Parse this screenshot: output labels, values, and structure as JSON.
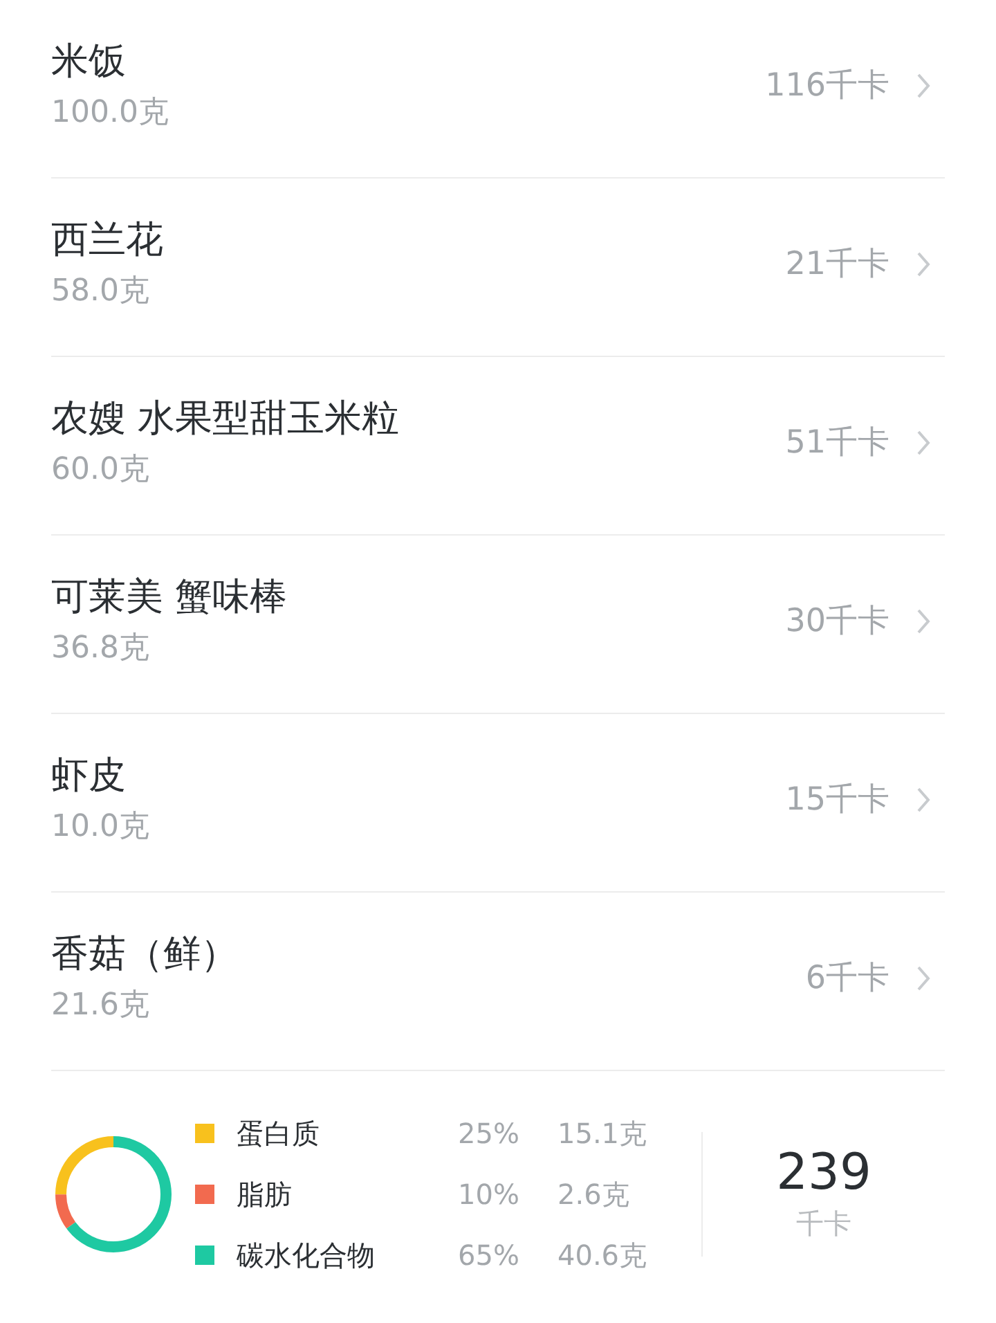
{
  "foods": [
    {
      "name": "米饭",
      "amount": "100.0克",
      "calories": "116千卡"
    },
    {
      "name": "西兰花",
      "amount": "58.0克",
      "calories": "21千卡"
    },
    {
      "name": "农嫂 水果型甜玉米粒",
      "amount": "60.0克",
      "calories": "51千卡"
    },
    {
      "name": "可莱美 蟹味棒",
      "amount": "36.8克",
      "calories": "30千卡"
    },
    {
      "name": "虾皮",
      "amount": "10.0克",
      "calories": "15千卡"
    },
    {
      "name": "香菇（鲜）",
      "amount": "21.6克",
      "calories": "6千卡"
    }
  ],
  "summary": {
    "nutrients": [
      {
        "name": "蛋白质",
        "percent": "25%",
        "amount": "15.1克",
        "color": "#f8c11d"
      },
      {
        "name": "脂肪",
        "percent": "10%",
        "amount": "2.6克",
        "color": "#f26a4f"
      },
      {
        "name": "碳水化合物",
        "percent": "65%",
        "amount": "40.6克",
        "color": "#1ec9a2"
      }
    ],
    "total": "239",
    "total_unit": "千卡"
  }
}
